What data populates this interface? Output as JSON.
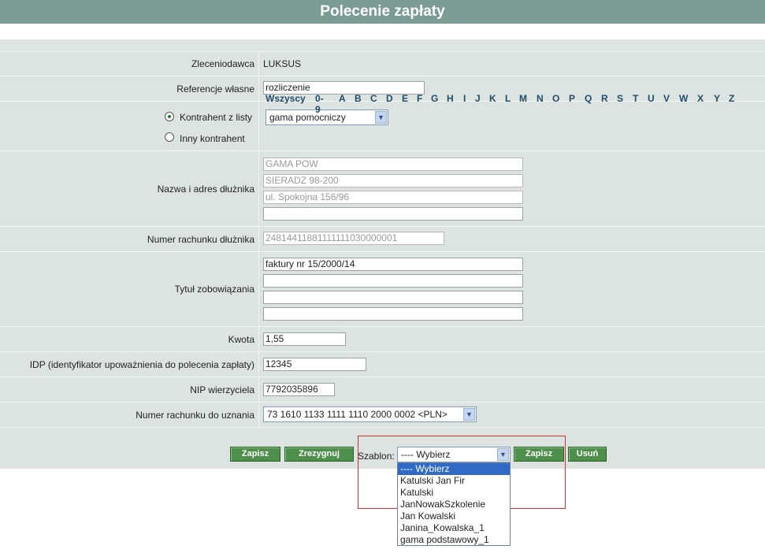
{
  "header": {
    "title": "Polecenie zapłaty"
  },
  "form": {
    "zleceniodawca": {
      "label": "Zleceniodawca",
      "value": "LUKSUS"
    },
    "referencje": {
      "label": "Referencje własne",
      "value": "rozliczenie"
    },
    "kontrahent": {
      "radio_list_label": "Kontrahent z listy",
      "radio_other_label": "Inny kontrahent",
      "selected_option": "gama pomocniczy",
      "letters": [
        "Wszyscy",
        "0-9",
        "A",
        "B",
        "C",
        "D",
        "E",
        "F",
        "G",
        "H",
        "I",
        "J",
        "K",
        "L",
        "M",
        "N",
        "O",
        "P",
        "Q",
        "R",
        "S",
        "T",
        "U",
        "V",
        "W",
        "X",
        "Y",
        "Z"
      ]
    },
    "dluznik": {
      "label": "Nazwa i adres dłużnika",
      "lines": [
        "GAMA POW",
        "SIERADZ 98-200",
        "ul. Spokojna 156/96",
        ""
      ]
    },
    "rachunek_dluznika": {
      "label": "Numer rachunku dłużnika",
      "value": "24814411881111111030000001"
    },
    "tytul": {
      "label": "Tytuł zobowiązania",
      "lines": [
        "faktury nr 15/2000/14",
        "",
        "",
        ""
      ]
    },
    "kwota": {
      "label": "Kwota",
      "value": "1,55"
    },
    "idp": {
      "label": "IDP (identyfikator upoważnienia do polecenia zapłaty)",
      "value": "12345"
    },
    "nip": {
      "label": "NIP wierzyciela",
      "value": "7792035896"
    },
    "rachunek_uznania": {
      "label": "Numer rachunku do uznania",
      "value": "73 1610 1133 1111 1110 2000 0002 <PLN>"
    }
  },
  "buttons": {
    "zapisz": "Zapisz",
    "zrezygnuj": "Zrezygnuj",
    "szablon_label": "Szablon:",
    "szablon_selected": "---- Wybierz",
    "zapisz_szablon": "Zapisz",
    "usun": "Usuń"
  },
  "szablon_options": [
    "---- Wybierz",
    "Katulski Jan Fir",
    "Katulski",
    "JanNowakSzkolenie",
    "Jan Kowalski",
    "Janina_Kowalska_1",
    "gama podstawowy_1"
  ],
  "colors": {
    "header_bg": "#7b9c92",
    "form_bg": "#dde3e1",
    "button_bg": "#4e8f4b",
    "highlight": "#316ac5",
    "frame_red": "#d3302f"
  }
}
